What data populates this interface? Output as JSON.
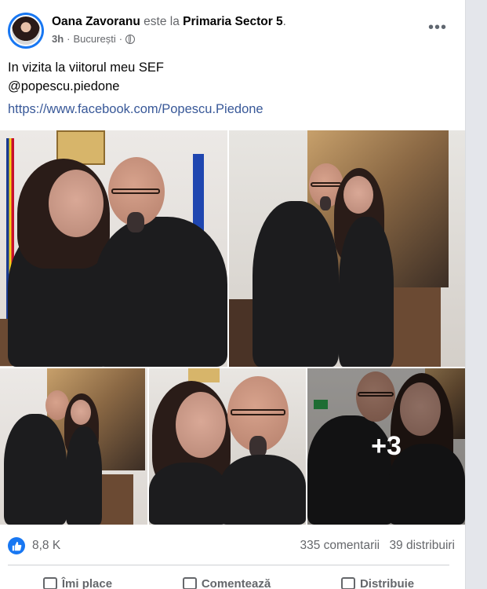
{
  "post": {
    "author": "Oana Zavoranu",
    "connector": "este la",
    "place": "Primaria Sector 5",
    "place_suffix": ".",
    "time": "3h",
    "separator": "·",
    "location": "București",
    "privacy_icon": "globe-icon",
    "more_label": "•••",
    "text_line1": "In vizita la viitorul meu SEF",
    "text_line2": "@popescu.piedone",
    "link": "https://www.facebook.com/Popescu.Piedone"
  },
  "photos": {
    "more_count": "+3"
  },
  "stats": {
    "reaction_icon": "thumbs-up-icon",
    "likes": "8,8 K",
    "comments": "335 comentarii",
    "shares": "39 distribuiri"
  },
  "actions": {
    "like": "Îmi place",
    "comment": "Comentează",
    "share": "Distribuie"
  },
  "colors": {
    "accent": "#1877f2",
    "link": "#385898",
    "secondary_text": "#65676b"
  }
}
